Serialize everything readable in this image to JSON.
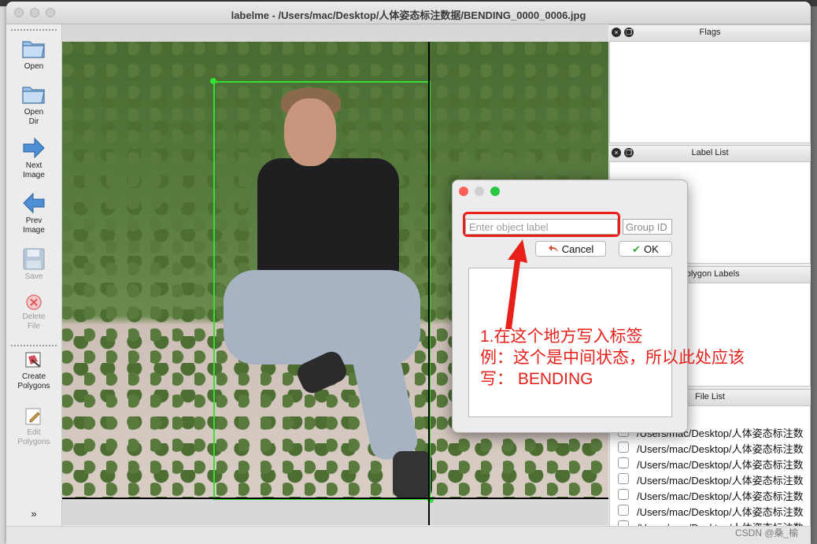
{
  "window": {
    "title": "labelme - /Users/mac/Desktop/人体姿态标注数据/BENDING_0000_0006.jpg"
  },
  "toolbar": {
    "open": "Open",
    "open_dir": "Open\nDir",
    "next_image": "Next\nImage",
    "prev_image": "Prev\nImage",
    "save": "Save",
    "delete_file": "Delete\nFile",
    "create_polygons": "Create\nPolygons",
    "edit_polygons": "Edit\nPolygons"
  },
  "docks": {
    "flags": "Flags",
    "label_list": "Label List",
    "polygon_labels": "Polygon Labels",
    "file_list": "File List"
  },
  "file_list": [
    "/Users/mac/Desktop/人体姿态标注数",
    "/Users/mac/Desktop/人体姿态标注数",
    "/Users/mac/Desktop/人体姿态标注数",
    "/Users/mac/Desktop/人体姿态标注数",
    "/Users/mac/Desktop/人体姿态标注数",
    "/Users/mac/Desktop/人体姿态标注数",
    "/Users/mac/Desktop/人体姿态标注数"
  ],
  "dialog": {
    "label_placeholder": "Enter object label",
    "label_value": "",
    "group_placeholder": "Group ID",
    "cancel": "Cancel",
    "ok": "OK"
  },
  "annotation": {
    "line1": "1.在这个地方写入标签",
    "line2": "例：这个是中间状态，所以此处应该",
    "line3": "写：  BENDING"
  },
  "watermark": "CSDN @桑_榆",
  "colors": {
    "bbox": "#35e035",
    "annotation": "#e8201a",
    "close": "#fe5f57",
    "minimize": "#febc2e",
    "maximize": "#28c840"
  },
  "icons": {
    "open": "folder-icon",
    "open_dir": "folder-icon",
    "next": "arrow-right-icon",
    "prev": "arrow-left-icon",
    "save": "floppy-disk-icon",
    "delete": "delete-icon",
    "create": "polygon-icon",
    "edit": "edit-icon",
    "more": "chevron-down-icon"
  }
}
